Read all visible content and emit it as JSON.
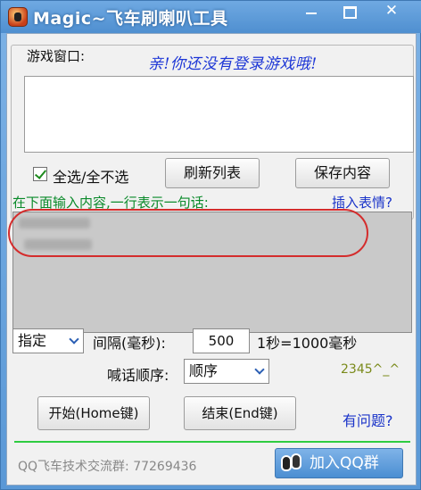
{
  "window": {
    "title": "Magic~飞车刷喇叭工具",
    "minimize_glyph": "—",
    "maximize_glyph": "☐",
    "close_glyph": "✕"
  },
  "game_window_group": {
    "label": "游戏窗口:",
    "login_message": "亲!你还没有登录游戏哦!",
    "select_all_label": "全选/全不选",
    "select_all_checked": true,
    "refresh_button": "刷新列表",
    "save_button": "保存内容"
  },
  "message_input": {
    "hint": "在下面输入内容,一行表示一句话:",
    "insert_emoji_link": "插入表情?"
  },
  "settings": {
    "mode_value": "指定",
    "interval_label": "间隔(毫秒):",
    "interval_value": "500",
    "interval_note": "1秒=1000毫秒",
    "order_label": "喊话顺序:",
    "order_value": "顺序",
    "signature": "2345^_^"
  },
  "actions": {
    "start_button": "开始(Home键)",
    "end_button": "结束(End键)",
    "help_link": "有问题?"
  },
  "footer": {
    "qq_group_text": "QQ飞车技术交流群: 77269436",
    "join_qq_button": "加入QQ群"
  },
  "colors": {
    "title_bar": "#5a98d6",
    "login_message": "#1d36d6",
    "hint_green": "#0a8a2a",
    "link_blue": "#1a34c9",
    "divider_green": "#2ecc40",
    "highlight_red": "#d42c2c"
  },
  "icons": [
    "app-icon",
    "minimize-icon",
    "maximize-icon",
    "close-icon",
    "checkmark-icon",
    "chevron-down-icon",
    "qq-icon"
  ]
}
